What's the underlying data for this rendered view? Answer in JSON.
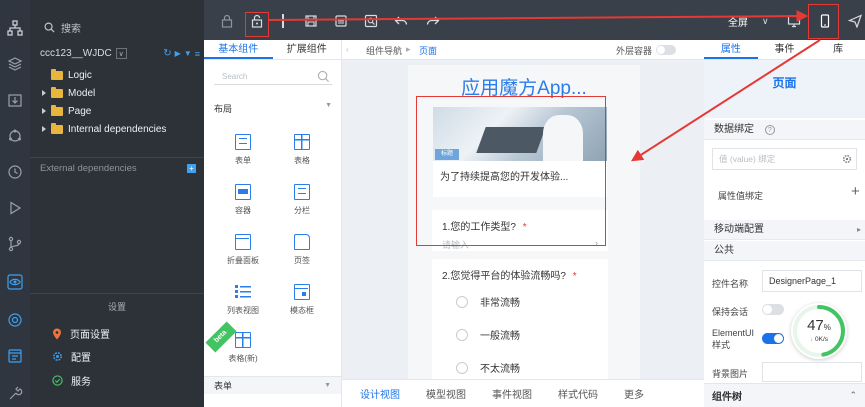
{
  "explorer": {
    "search_placeholder": "搜索",
    "project_name": "ccc123__WJDC",
    "tree": [
      "Logic",
      "Model",
      "Page",
      "Internal dependencies"
    ],
    "external_label": "External dependencies",
    "settings_heading": "设置",
    "bottom_items": [
      "页面设置",
      "配置",
      "服务"
    ]
  },
  "toolbar": {
    "fullscreen_label": "全屏"
  },
  "components": {
    "tabs": [
      "基本组件",
      "扩展组件"
    ],
    "search_placeholder": "Search",
    "group_layout": "布局",
    "items": [
      "表单",
      "表格",
      "容器",
      "分栏",
      "折叠面板",
      "页签",
      "列表视图",
      "模态框",
      "表格(新)"
    ],
    "beta_badge": "beta",
    "group_next": "表单"
  },
  "canvas": {
    "breadcrumb_nav": "组件导航",
    "breadcrumb_current": "页面",
    "outer_container_label": "外层容器",
    "app_title": "应用魔方App...",
    "banner_tag": "标题",
    "banner_caption": "为了持续提高您的开发体验...",
    "q1_label": "1.您的工作类型?",
    "q1_placeholder": "请输入",
    "q2_label": "2.您觉得平台的体验流畅吗?",
    "required_mark": "*",
    "options": [
      "非常流畅",
      "一般流畅",
      "不太流畅"
    ],
    "bottom_tabs": [
      "设计视图",
      "模型视图",
      "事件视图",
      "样式代码",
      "更多"
    ]
  },
  "properties": {
    "tabs": [
      "属性",
      "事件",
      "库"
    ],
    "header": "页面",
    "data_binding": "数据绑定",
    "value_binding_placeholder": "值 (value) 绑定",
    "attr_binding": "属性值绑定",
    "mobile_config": "移动端配置",
    "common": "公共",
    "control_name_label": "控件名称",
    "control_name_value": "DesignerPage_1",
    "keep_session_label": "保持会话",
    "elementui_label": "ElementUI样式",
    "bg_image_label": "背景图片",
    "component_tree": "组件树",
    "gauge_value": "47",
    "gauge_unit": "%",
    "gauge_speed": "0K/s"
  },
  "colors": {
    "accent": "#1a73e8",
    "annotation_red": "#e53935",
    "folder": "#e8b53d",
    "gauge_green": "#43c463"
  }
}
